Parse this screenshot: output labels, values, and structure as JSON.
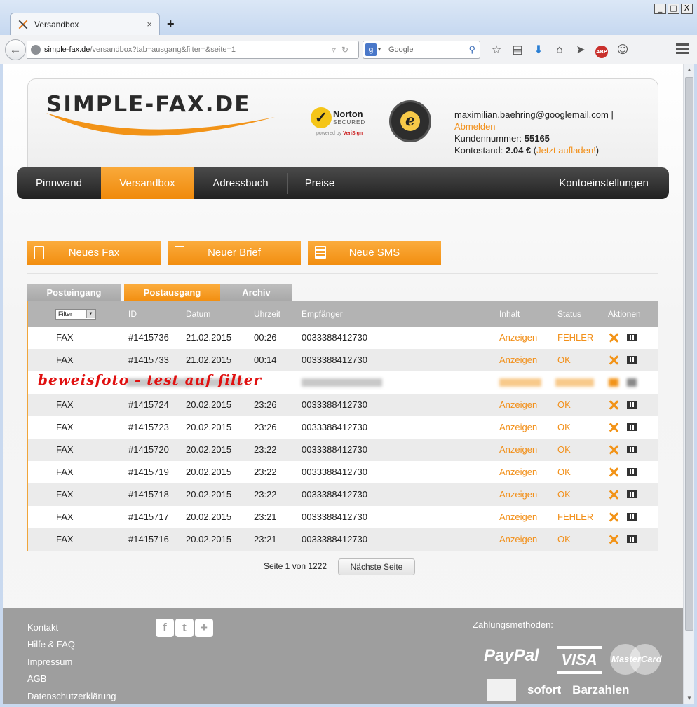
{
  "browser": {
    "tab_title": "Versandbox",
    "tab_close": "×",
    "new_tab": "+",
    "window_controls": [
      "_",
      "□",
      "X"
    ],
    "url_host": "simple-fax.de",
    "url_path": "/versandbox?tab=ausgang&filter=&seite=1",
    "search_engine_letter": "g",
    "search_placeholder": "Google",
    "icons": [
      "star-icon",
      "reading-list-icon",
      "download-icon",
      "home-icon",
      "send-icon",
      "adblock-icon",
      "chat-icon",
      "menu-icon"
    ]
  },
  "header": {
    "logo_text": "SIMPLE-FAX.DE",
    "norton": {
      "title": "Norton",
      "secured": "SECURED",
      "powered": "powered by",
      "verisign": "VeriSign"
    },
    "trusted_shops_letter": "e",
    "account": {
      "email": "maximilian.baehring@googlemail.com",
      "separator": "|",
      "logout": "Abmelden",
      "customer_label": "Kundennummer:",
      "customer_number": "55165",
      "balance_label": "Kontostand:",
      "balance_value": "2.04 €",
      "topup_link": "Jetzt aufladen!",
      "paren_open": "(",
      "paren_close": ")"
    }
  },
  "nav": {
    "items": [
      "Pinnwand",
      "Versandbox",
      "Adressbuch",
      "Preise"
    ],
    "active": "Versandbox",
    "right": "Kontoeinstellungen"
  },
  "actions": {
    "fax": "Neues Fax",
    "letter": "Neuer Brief",
    "sms": "Neue SMS"
  },
  "subtabs": {
    "items": [
      "Posteingang",
      "Postausgang",
      "Archiv"
    ],
    "active": "Postausgang"
  },
  "table": {
    "filter_value": "Filter",
    "headers": {
      "id": "ID",
      "date": "Datum",
      "time": "Uhrzeit",
      "recipient": "Empfänger",
      "content": "Inhalt",
      "status": "Status",
      "actions": "Aktionen"
    },
    "rows": [
      {
        "type": "FAX",
        "id": "#1415736",
        "date": "21.02.2015",
        "time": "00:26",
        "recipient": "0033388412730",
        "content": "Anzeigen",
        "status": "FEHLER"
      },
      {
        "type": "FAX",
        "id": "#1415733",
        "date": "21.02.2015",
        "time": "00:14",
        "recipient": "0033388412730",
        "content": "Anzeigen",
        "status": "OK"
      },
      {
        "type": "FAX",
        "id": "#1415724",
        "date": "20.02.2015",
        "time": "23:26",
        "recipient": "0033388412730",
        "content": "Anzeigen",
        "status": "OK"
      },
      {
        "type": "FAX",
        "id": "#1415723",
        "date": "20.02.2015",
        "time": "23:26",
        "recipient": "0033388412730",
        "content": "Anzeigen",
        "status": "OK"
      },
      {
        "type": "FAX",
        "id": "#1415720",
        "date": "20.02.2015",
        "time": "23:22",
        "recipient": "0033388412730",
        "content": "Anzeigen",
        "status": "OK"
      },
      {
        "type": "FAX",
        "id": "#1415719",
        "date": "20.02.2015",
        "time": "23:22",
        "recipient": "0033388412730",
        "content": "Anzeigen",
        "status": "OK"
      },
      {
        "type": "FAX",
        "id": "#1415718",
        "date": "20.02.2015",
        "time": "23:22",
        "recipient": "0033388412730",
        "content": "Anzeigen",
        "status": "OK"
      },
      {
        "type": "FAX",
        "id": "#1415717",
        "date": "20.02.2015",
        "time": "23:21",
        "recipient": "0033388412730",
        "content": "Anzeigen",
        "status": "FEHLER"
      },
      {
        "type": "FAX",
        "id": "#1415716",
        "date": "20.02.2015",
        "time": "23:21",
        "recipient": "0033388412730",
        "content": "Anzeigen",
        "status": "OK"
      }
    ],
    "overlay_text": "beweisfoto - test auf filter"
  },
  "pager": {
    "text": "Seite 1 von 1222",
    "next": "Nächste Seite"
  },
  "footer": {
    "links": [
      "Kontakt",
      "Hilfe & FAQ",
      "Impressum",
      "AGB",
      "Datenschutzerklärung"
    ],
    "social": [
      "f",
      "t",
      "+"
    ],
    "payment_title": "Zahlungsmethoden:",
    "paypal": "PayPal",
    "visa": "VISA",
    "mastercard": "MasterCard",
    "sofort": "sofort",
    "barzahlen": "Barzahlen"
  },
  "colors": {
    "accent": "#f2901a",
    "nav_dark": "#2a2a2a",
    "table_header": "#b3b3b3",
    "overlay_red": "#e01010"
  }
}
